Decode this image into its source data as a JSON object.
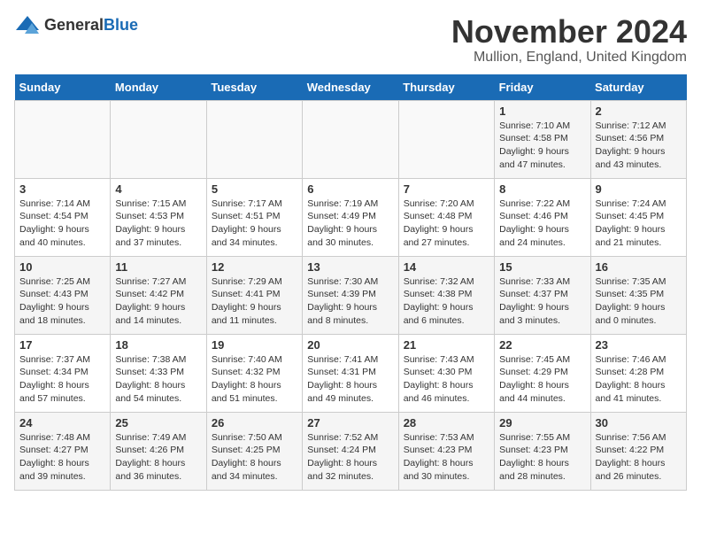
{
  "logo": {
    "general": "General",
    "blue": "Blue"
  },
  "title": "November 2024",
  "location": "Mullion, England, United Kingdom",
  "weekdays": [
    "Sunday",
    "Monday",
    "Tuesday",
    "Wednesday",
    "Thursday",
    "Friday",
    "Saturday"
  ],
  "weeks": [
    [
      {
        "day": "",
        "info": ""
      },
      {
        "day": "",
        "info": ""
      },
      {
        "day": "",
        "info": ""
      },
      {
        "day": "",
        "info": ""
      },
      {
        "day": "",
        "info": ""
      },
      {
        "day": "1",
        "info": "Sunrise: 7:10 AM\nSunset: 4:58 PM\nDaylight: 9 hours\nand 47 minutes."
      },
      {
        "day": "2",
        "info": "Sunrise: 7:12 AM\nSunset: 4:56 PM\nDaylight: 9 hours\nand 43 minutes."
      }
    ],
    [
      {
        "day": "3",
        "info": "Sunrise: 7:14 AM\nSunset: 4:54 PM\nDaylight: 9 hours\nand 40 minutes."
      },
      {
        "day": "4",
        "info": "Sunrise: 7:15 AM\nSunset: 4:53 PM\nDaylight: 9 hours\nand 37 minutes."
      },
      {
        "day": "5",
        "info": "Sunrise: 7:17 AM\nSunset: 4:51 PM\nDaylight: 9 hours\nand 34 minutes."
      },
      {
        "day": "6",
        "info": "Sunrise: 7:19 AM\nSunset: 4:49 PM\nDaylight: 9 hours\nand 30 minutes."
      },
      {
        "day": "7",
        "info": "Sunrise: 7:20 AM\nSunset: 4:48 PM\nDaylight: 9 hours\nand 27 minutes."
      },
      {
        "day": "8",
        "info": "Sunrise: 7:22 AM\nSunset: 4:46 PM\nDaylight: 9 hours\nand 24 minutes."
      },
      {
        "day": "9",
        "info": "Sunrise: 7:24 AM\nSunset: 4:45 PM\nDaylight: 9 hours\nand 21 minutes."
      }
    ],
    [
      {
        "day": "10",
        "info": "Sunrise: 7:25 AM\nSunset: 4:43 PM\nDaylight: 9 hours\nand 18 minutes."
      },
      {
        "day": "11",
        "info": "Sunrise: 7:27 AM\nSunset: 4:42 PM\nDaylight: 9 hours\nand 14 minutes."
      },
      {
        "day": "12",
        "info": "Sunrise: 7:29 AM\nSunset: 4:41 PM\nDaylight: 9 hours\nand 11 minutes."
      },
      {
        "day": "13",
        "info": "Sunrise: 7:30 AM\nSunset: 4:39 PM\nDaylight: 9 hours\nand 8 minutes."
      },
      {
        "day": "14",
        "info": "Sunrise: 7:32 AM\nSunset: 4:38 PM\nDaylight: 9 hours\nand 6 minutes."
      },
      {
        "day": "15",
        "info": "Sunrise: 7:33 AM\nSunset: 4:37 PM\nDaylight: 9 hours\nand 3 minutes."
      },
      {
        "day": "16",
        "info": "Sunrise: 7:35 AM\nSunset: 4:35 PM\nDaylight: 9 hours\nand 0 minutes."
      }
    ],
    [
      {
        "day": "17",
        "info": "Sunrise: 7:37 AM\nSunset: 4:34 PM\nDaylight: 8 hours\nand 57 minutes."
      },
      {
        "day": "18",
        "info": "Sunrise: 7:38 AM\nSunset: 4:33 PM\nDaylight: 8 hours\nand 54 minutes."
      },
      {
        "day": "19",
        "info": "Sunrise: 7:40 AM\nSunset: 4:32 PM\nDaylight: 8 hours\nand 51 minutes."
      },
      {
        "day": "20",
        "info": "Sunrise: 7:41 AM\nSunset: 4:31 PM\nDaylight: 8 hours\nand 49 minutes."
      },
      {
        "day": "21",
        "info": "Sunrise: 7:43 AM\nSunset: 4:30 PM\nDaylight: 8 hours\nand 46 minutes."
      },
      {
        "day": "22",
        "info": "Sunrise: 7:45 AM\nSunset: 4:29 PM\nDaylight: 8 hours\nand 44 minutes."
      },
      {
        "day": "23",
        "info": "Sunrise: 7:46 AM\nSunset: 4:28 PM\nDaylight: 8 hours\nand 41 minutes."
      }
    ],
    [
      {
        "day": "24",
        "info": "Sunrise: 7:48 AM\nSunset: 4:27 PM\nDaylight: 8 hours\nand 39 minutes."
      },
      {
        "day": "25",
        "info": "Sunrise: 7:49 AM\nSunset: 4:26 PM\nDaylight: 8 hours\nand 36 minutes."
      },
      {
        "day": "26",
        "info": "Sunrise: 7:50 AM\nSunset: 4:25 PM\nDaylight: 8 hours\nand 34 minutes."
      },
      {
        "day": "27",
        "info": "Sunrise: 7:52 AM\nSunset: 4:24 PM\nDaylight: 8 hours\nand 32 minutes."
      },
      {
        "day": "28",
        "info": "Sunrise: 7:53 AM\nSunset: 4:23 PM\nDaylight: 8 hours\nand 30 minutes."
      },
      {
        "day": "29",
        "info": "Sunrise: 7:55 AM\nSunset: 4:23 PM\nDaylight: 8 hours\nand 28 minutes."
      },
      {
        "day": "30",
        "info": "Sunrise: 7:56 AM\nSunset: 4:22 PM\nDaylight: 8 hours\nand 26 minutes."
      }
    ]
  ]
}
